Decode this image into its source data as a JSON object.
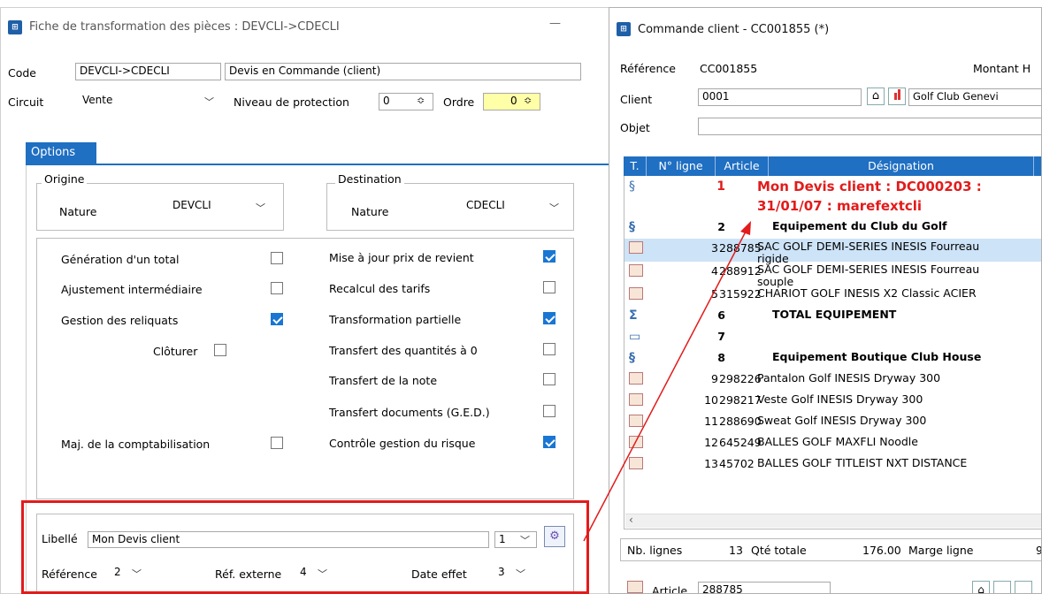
{
  "left": {
    "title": "Fiche de transformation des pièces : DEVCLI->CDECLI",
    "minimize": "—",
    "code_label": "Code",
    "code_value": "DEVCLI->CDECLI",
    "code_desc": "Devis en Commande (client)",
    "circuit_label": "Circuit",
    "circuit_value": "Vente",
    "niveau_label": "Niveau de protection",
    "niveau_value": "0",
    "ordre_label": "Ordre",
    "ordre_value": "0",
    "tab_options": "Options",
    "origine_title": "Origine",
    "origine_nature_label": "Nature",
    "origine_nature_value": "DEVCLI",
    "dest_title": "Destination",
    "dest_nature_label": "Nature",
    "dest_nature_value": "CDECLI",
    "options": {
      "gen_total": "Génération d'un total",
      "ajust": "Ajustement intermédiaire",
      "reliquats": "Gestion des reliquats",
      "cloturer": "Clôturer",
      "maj_compta": "Maj. de la comptabilisation",
      "maj_prix": "Mise à jour prix de revient",
      "recalcul": "Recalcul des tarifs",
      "transfo": "Transformation partielle",
      "transf_qte": "Transfert des quantités à 0",
      "transf_note": "Transfert de la note",
      "transf_ged": "Transfert documents (G.E.D.)",
      "controle": "Contrôle gestion du risque"
    },
    "libelle_label": "Libellé",
    "libelle_value": "Mon Devis client",
    "libelle_num": "1",
    "reference_label": "Référence",
    "reference_value": "2",
    "refext_label": "Réf. externe",
    "refext_value": "4",
    "dateeffet_label": "Date effet",
    "dateeffet_value": "3"
  },
  "right": {
    "title": "Commande client - CC001855 (*)",
    "reference_label": "Référence",
    "reference_value": "CC001855",
    "montant_label": "Montant H",
    "client_label": "Client",
    "client_value": "0001",
    "client_name": "Golf Club Genevi",
    "objet_label": "Objet",
    "headers": {
      "t": "T.",
      "nligne": "N° ligne",
      "article": "Article",
      "designation": "Désignation"
    },
    "rows": [
      {
        "icon": "section-icon",
        "n": "1",
        "article": "",
        "des": "Mon Devis client : DC000203 :",
        "des2": "31/01/07 : marefextcli",
        "style": "red"
      },
      {
        "icon": "section-icon",
        "n": "2",
        "article": "",
        "des": "Equipement du Club du Golf",
        "style": "bold"
      },
      {
        "icon": "article-icon",
        "n": "3",
        "article": "288785",
        "des": "SAC GOLF DEMI-SERIES INESIS Fourreau",
        "des2": "rigide",
        "style": "sel"
      },
      {
        "icon": "article-icon",
        "n": "4",
        "article": "288912",
        "des": "SAC GOLF DEMI-SERIES INESIS Fourreau",
        "des2": "souple",
        "style": ""
      },
      {
        "icon": "article-icon",
        "n": "5",
        "article": "315922",
        "des": "CHARIOT GOLF INESIS X2 Classic ACIER",
        "style": ""
      },
      {
        "icon": "sum-icon",
        "n": "6",
        "article": "",
        "des": "TOTAL EQUIPEMENT",
        "style": "bold"
      },
      {
        "icon": "comment-icon",
        "n": "7",
        "article": "",
        "des": "",
        "style": "bold"
      },
      {
        "icon": "section-icon",
        "n": "8",
        "article": "",
        "des": "Equipement Boutique Club House",
        "style": "bold"
      },
      {
        "icon": "article-icon",
        "n": "9",
        "article": "298226",
        "des": "Pantalon Golf INESIS Dryway 300",
        "style": ""
      },
      {
        "icon": "article-icon",
        "n": "10",
        "article": "298217",
        "des": "Veste Golf INESIS Dryway 300",
        "style": ""
      },
      {
        "icon": "article-icon",
        "n": "11",
        "article": "288690",
        "des": "Sweat Golf INESIS Dryway 300",
        "style": ""
      },
      {
        "icon": "article-icon",
        "n": "12",
        "article": "645249",
        "des": "BALLES GOLF MAXFLI Noodle",
        "style": ""
      },
      {
        "icon": "article-icon",
        "n": "13",
        "article": "45702",
        "des": "BALLES GOLF TITLEIST NXT DISTANCE",
        "style": ""
      }
    ],
    "nb_lignes_label": "Nb. lignes",
    "nb_lignes_value": "13",
    "qte_label": "Qté totale",
    "qte_value": "176.00",
    "marge_label": "Marge ligne",
    "marge_value": "9",
    "article_label": "Article",
    "article_value": "288785"
  },
  "colors": {
    "accent": "#1f6fc2",
    "highlight": "#e21b1b",
    "selected_row": "#cde3f7"
  }
}
